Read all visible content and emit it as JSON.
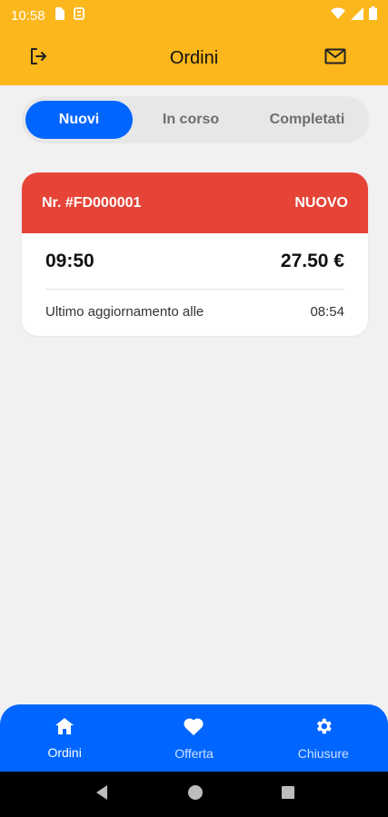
{
  "status_bar": {
    "time": "10:58"
  },
  "header": {
    "title": "Ordini",
    "left_icon": "logout-icon",
    "right_icon": "mail-icon"
  },
  "tabs": [
    {
      "label": "Nuovi",
      "active": true
    },
    {
      "label": "In corso",
      "active": false
    },
    {
      "label": "Completati",
      "active": false
    }
  ],
  "order": {
    "number": "Nr. #FD000001",
    "status": "NUOVO",
    "time": "09:50",
    "amount": "27.50 €",
    "update_label": "Ultimo aggiornamento alle",
    "update_time": "08:54"
  },
  "bottom_nav": [
    {
      "label": "Ordini",
      "icon": "home-icon",
      "active": true
    },
    {
      "label": "Offerta",
      "icon": "heart-icon",
      "active": false
    },
    {
      "label": "Chiusure",
      "icon": "settings-icon",
      "active": false
    }
  ],
  "colors": {
    "primary": "#0066ff",
    "header": "#fbb71b",
    "status_new": "#e54437",
    "background": "#f1f1f1"
  }
}
